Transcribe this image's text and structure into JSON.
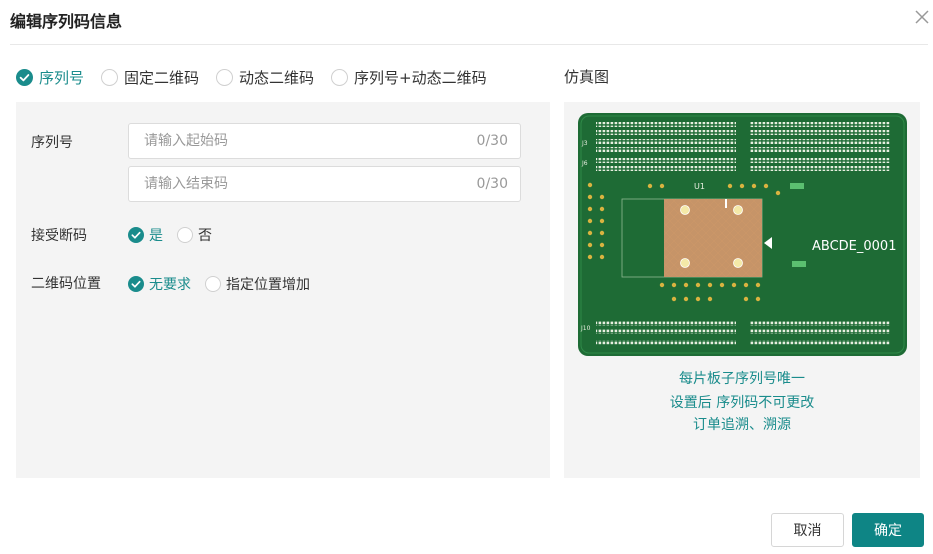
{
  "dialog": {
    "title": "编辑序列码信息"
  },
  "modes": [
    {
      "label": "序列号",
      "selected": true
    },
    {
      "label": "固定二维码",
      "selected": false
    },
    {
      "label": "动态二维码",
      "selected": false
    },
    {
      "label": "序列号+动态二维码",
      "selected": false
    }
  ],
  "form": {
    "serial": {
      "label": "序列号",
      "start": {
        "placeholder": "请输入起始码",
        "value": "",
        "count": "0/30"
      },
      "end": {
        "placeholder": "请输入结束码",
        "value": "",
        "count": "0/30"
      }
    },
    "accept_break": {
      "label": "接受断码",
      "options": [
        {
          "label": "是",
          "selected": true
        },
        {
          "label": "否",
          "selected": false
        }
      ]
    },
    "qr_position": {
      "label": "二维码位置",
      "options": [
        {
          "label": "无要求",
          "selected": true
        },
        {
          "label": "指定位置增加",
          "selected": false
        }
      ]
    }
  },
  "preview": {
    "title": "仿真图",
    "board": {
      "chip_label": "U1",
      "serial_text": "ABCDE_0001",
      "headers": [
        "J3",
        "J6",
        "J10"
      ]
    },
    "captions": [
      "每片板子序列号唯一",
      "设置后 序列码不可更改",
      "订单追溯、溯源"
    ]
  },
  "buttons": {
    "cancel": "取消",
    "ok": "确定"
  },
  "colors": {
    "accent": "#1a8c8c",
    "primary_button": "#0e8585",
    "pcb_green": "#1e6b35",
    "panel_bg": "#f4f4f4"
  }
}
